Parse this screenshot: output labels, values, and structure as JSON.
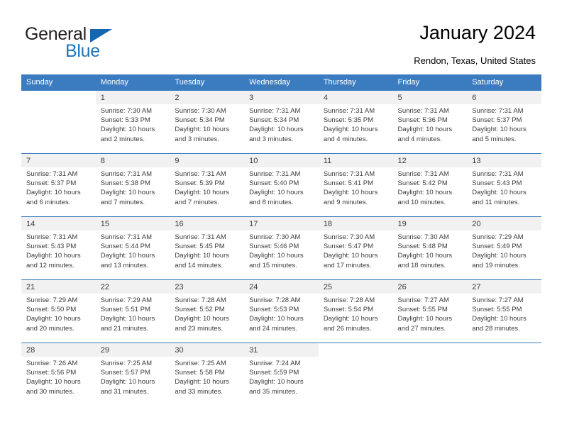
{
  "brand": {
    "name_top": "General",
    "name_bottom": "Blue",
    "triangle_color": "#1565b0",
    "blue_color": "#1c75bc",
    "dark_color": "#231f20"
  },
  "header": {
    "title": "January 2024",
    "subtitle": "Rendon, Texas, United States"
  },
  "theme": {
    "header_bg": "#3a7cbf",
    "header_text": "#ffffff",
    "daynum_bg": "#f1f1f1",
    "body_text": "#3b3b3b"
  },
  "calendar": {
    "weekday_headers": [
      "Sunday",
      "Monday",
      "Tuesday",
      "Wednesday",
      "Thursday",
      "Friday",
      "Saturday"
    ],
    "weeks": [
      [
        {
          "day": "",
          "sunrise": "",
          "sunset": "",
          "daylight": "",
          "empty": true
        },
        {
          "day": "1",
          "sunrise": "Sunrise: 7:30 AM",
          "sunset": "Sunset: 5:33 PM",
          "daylight": "Daylight: 10 hours and 2 minutes."
        },
        {
          "day": "2",
          "sunrise": "Sunrise: 7:30 AM",
          "sunset": "Sunset: 5:34 PM",
          "daylight": "Daylight: 10 hours and 3 minutes."
        },
        {
          "day": "3",
          "sunrise": "Sunrise: 7:31 AM",
          "sunset": "Sunset: 5:34 PM",
          "daylight": "Daylight: 10 hours and 3 minutes."
        },
        {
          "day": "4",
          "sunrise": "Sunrise: 7:31 AM",
          "sunset": "Sunset: 5:35 PM",
          "daylight": "Daylight: 10 hours and 4 minutes."
        },
        {
          "day": "5",
          "sunrise": "Sunrise: 7:31 AM",
          "sunset": "Sunset: 5:36 PM",
          "daylight": "Daylight: 10 hours and 4 minutes."
        },
        {
          "day": "6",
          "sunrise": "Sunrise: 7:31 AM",
          "sunset": "Sunset: 5:37 PM",
          "daylight": "Daylight: 10 hours and 5 minutes."
        }
      ],
      [
        {
          "day": "7",
          "sunrise": "Sunrise: 7:31 AM",
          "sunset": "Sunset: 5:37 PM",
          "daylight": "Daylight: 10 hours and 6 minutes."
        },
        {
          "day": "8",
          "sunrise": "Sunrise: 7:31 AM",
          "sunset": "Sunset: 5:38 PM",
          "daylight": "Daylight: 10 hours and 7 minutes."
        },
        {
          "day": "9",
          "sunrise": "Sunrise: 7:31 AM",
          "sunset": "Sunset: 5:39 PM",
          "daylight": "Daylight: 10 hours and 7 minutes."
        },
        {
          "day": "10",
          "sunrise": "Sunrise: 7:31 AM",
          "sunset": "Sunset: 5:40 PM",
          "daylight": "Daylight: 10 hours and 8 minutes."
        },
        {
          "day": "11",
          "sunrise": "Sunrise: 7:31 AM",
          "sunset": "Sunset: 5:41 PM",
          "daylight": "Daylight: 10 hours and 9 minutes."
        },
        {
          "day": "12",
          "sunrise": "Sunrise: 7:31 AM",
          "sunset": "Sunset: 5:42 PM",
          "daylight": "Daylight: 10 hours and 10 minutes."
        },
        {
          "day": "13",
          "sunrise": "Sunrise: 7:31 AM",
          "sunset": "Sunset: 5:43 PM",
          "daylight": "Daylight: 10 hours and 11 minutes."
        }
      ],
      [
        {
          "day": "14",
          "sunrise": "Sunrise: 7:31 AM",
          "sunset": "Sunset: 5:43 PM",
          "daylight": "Daylight: 10 hours and 12 minutes."
        },
        {
          "day": "15",
          "sunrise": "Sunrise: 7:31 AM",
          "sunset": "Sunset: 5:44 PM",
          "daylight": "Daylight: 10 hours and 13 minutes."
        },
        {
          "day": "16",
          "sunrise": "Sunrise: 7:31 AM",
          "sunset": "Sunset: 5:45 PM",
          "daylight": "Daylight: 10 hours and 14 minutes."
        },
        {
          "day": "17",
          "sunrise": "Sunrise: 7:30 AM",
          "sunset": "Sunset: 5:46 PM",
          "daylight": "Daylight: 10 hours and 15 minutes."
        },
        {
          "day": "18",
          "sunrise": "Sunrise: 7:30 AM",
          "sunset": "Sunset: 5:47 PM",
          "daylight": "Daylight: 10 hours and 17 minutes."
        },
        {
          "day": "19",
          "sunrise": "Sunrise: 7:30 AM",
          "sunset": "Sunset: 5:48 PM",
          "daylight": "Daylight: 10 hours and 18 minutes."
        },
        {
          "day": "20",
          "sunrise": "Sunrise: 7:29 AM",
          "sunset": "Sunset: 5:49 PM",
          "daylight": "Daylight: 10 hours and 19 minutes."
        }
      ],
      [
        {
          "day": "21",
          "sunrise": "Sunrise: 7:29 AM",
          "sunset": "Sunset: 5:50 PM",
          "daylight": "Daylight: 10 hours and 20 minutes."
        },
        {
          "day": "22",
          "sunrise": "Sunrise: 7:29 AM",
          "sunset": "Sunset: 5:51 PM",
          "daylight": "Daylight: 10 hours and 21 minutes."
        },
        {
          "day": "23",
          "sunrise": "Sunrise: 7:28 AM",
          "sunset": "Sunset: 5:52 PM",
          "daylight": "Daylight: 10 hours and 23 minutes."
        },
        {
          "day": "24",
          "sunrise": "Sunrise: 7:28 AM",
          "sunset": "Sunset: 5:53 PM",
          "daylight": "Daylight: 10 hours and 24 minutes."
        },
        {
          "day": "25",
          "sunrise": "Sunrise: 7:28 AM",
          "sunset": "Sunset: 5:54 PM",
          "daylight": "Daylight: 10 hours and 26 minutes."
        },
        {
          "day": "26",
          "sunrise": "Sunrise: 7:27 AM",
          "sunset": "Sunset: 5:55 PM",
          "daylight": "Daylight: 10 hours and 27 minutes."
        },
        {
          "day": "27",
          "sunrise": "Sunrise: 7:27 AM",
          "sunset": "Sunset: 5:55 PM",
          "daylight": "Daylight: 10 hours and 28 minutes."
        }
      ],
      [
        {
          "day": "28",
          "sunrise": "Sunrise: 7:26 AM",
          "sunset": "Sunset: 5:56 PM",
          "daylight": "Daylight: 10 hours and 30 minutes."
        },
        {
          "day": "29",
          "sunrise": "Sunrise: 7:25 AM",
          "sunset": "Sunset: 5:57 PM",
          "daylight": "Daylight: 10 hours and 31 minutes."
        },
        {
          "day": "30",
          "sunrise": "Sunrise: 7:25 AM",
          "sunset": "Sunset: 5:58 PM",
          "daylight": "Daylight: 10 hours and 33 minutes."
        },
        {
          "day": "31",
          "sunrise": "Sunrise: 7:24 AM",
          "sunset": "Sunset: 5:59 PM",
          "daylight": "Daylight: 10 hours and 35 minutes."
        },
        {
          "day": "",
          "sunrise": "",
          "sunset": "",
          "daylight": "",
          "empty": true
        },
        {
          "day": "",
          "sunrise": "",
          "sunset": "",
          "daylight": "",
          "empty": true
        },
        {
          "day": "",
          "sunrise": "",
          "sunset": "",
          "daylight": "",
          "empty": true
        }
      ]
    ]
  }
}
